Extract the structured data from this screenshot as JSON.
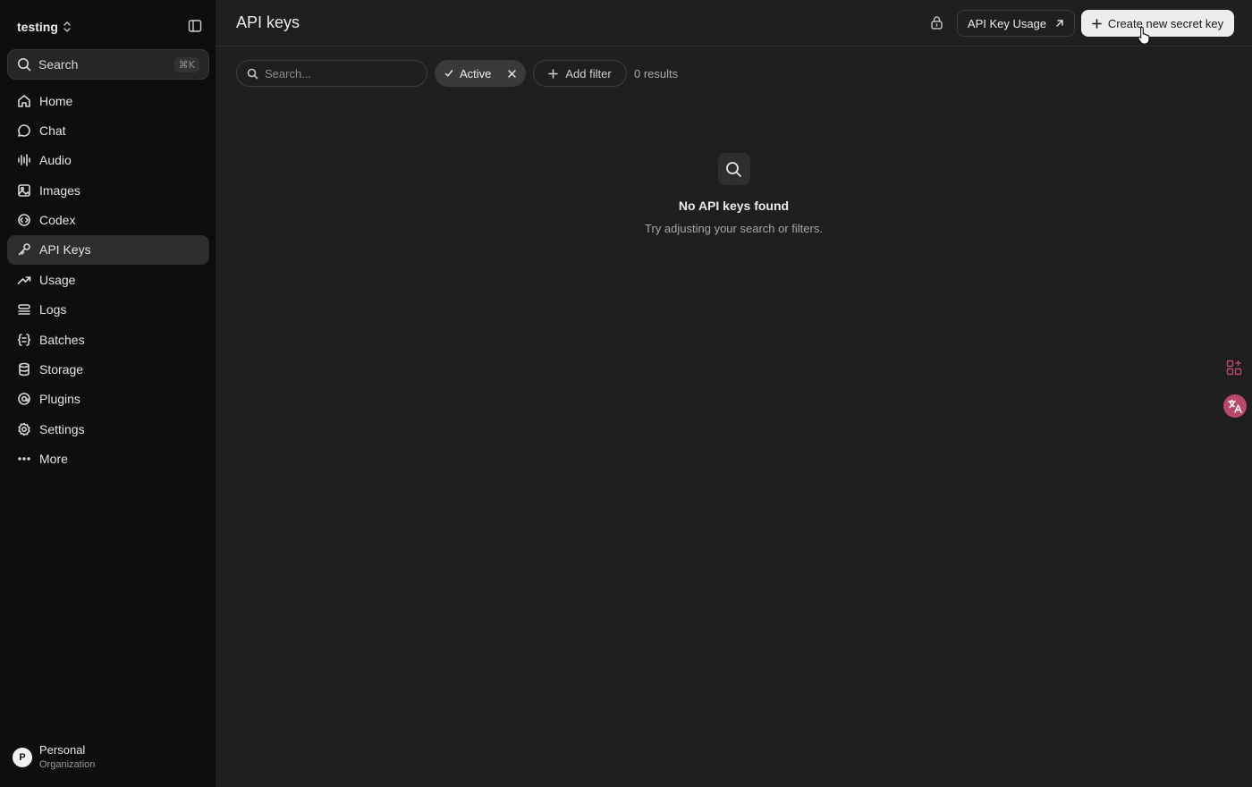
{
  "sidebar": {
    "project_name": "testing",
    "search_label": "Search",
    "search_shortcut": "⌘K",
    "items": [
      {
        "label": "Home",
        "icon": "home-icon"
      },
      {
        "label": "Chat",
        "icon": "chat-icon"
      },
      {
        "label": "Audio",
        "icon": "audio-icon"
      },
      {
        "label": "Images",
        "icon": "images-icon"
      },
      {
        "label": "Codex",
        "icon": "codex-icon"
      },
      {
        "label": "API Keys",
        "icon": "key-icon",
        "active": true
      },
      {
        "label": "Usage",
        "icon": "usage-icon"
      },
      {
        "label": "Logs",
        "icon": "logs-icon"
      },
      {
        "label": "Batches",
        "icon": "batches-icon"
      },
      {
        "label": "Storage",
        "icon": "storage-icon"
      },
      {
        "label": "Plugins",
        "icon": "plugins-icon"
      },
      {
        "label": "Settings",
        "icon": "settings-icon"
      },
      {
        "label": "More",
        "icon": "more-icon"
      }
    ],
    "org": {
      "avatar_letter": "P",
      "name": "Personal",
      "type": "Organization"
    }
  },
  "header": {
    "title": "API keys",
    "usage_button": "API Key Usage",
    "create_button": "Create new secret key"
  },
  "filters": {
    "search_placeholder": "Search...",
    "active_chip": "Active",
    "add_filter": "Add filter",
    "results": "0 results"
  },
  "empty_state": {
    "title": "No API keys found",
    "subtitle": "Try adjusting your search or filters."
  },
  "colors": {
    "sidebar_bg": "#0e0e0e",
    "main_bg": "#1f1f1f",
    "primary_button_bg": "#ededed",
    "translate_badge": "#b9496a"
  }
}
